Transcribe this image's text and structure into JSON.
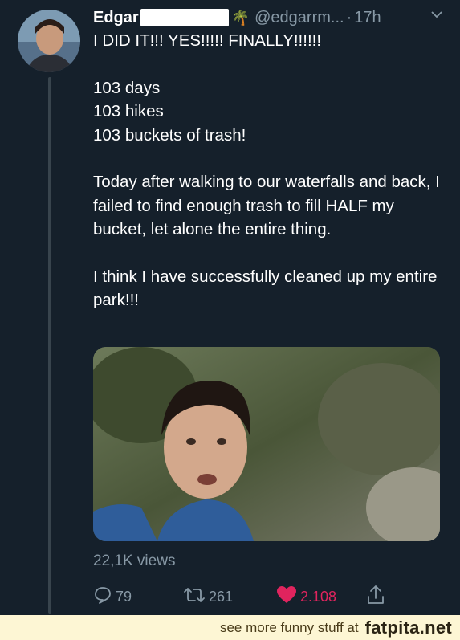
{
  "tweet": {
    "author_name": "Edgar",
    "author_emoji": "🌴",
    "handle": "@edgarrm...",
    "separator": "·",
    "time": "17h",
    "paragraphs": [
      "I DID IT!!! YES!!!!! FINALLY!!!!!!",
      "103 days\n103 hikes\n103 buckets of trash!",
      "Today after walking to our waterfalls and back, I failed to find enough trash to fill HALF my bucket, let alone the entire thing.",
      "I think I have successfully cleaned up my entire park!!!"
    ],
    "views": "22,1K views",
    "replies": "79",
    "retweets": "261",
    "likes": "2.108",
    "colors": {
      "background": "#15202b",
      "secondary_text": "#8899a6",
      "like": "#e0245e"
    }
  },
  "icons": {
    "caret": "chevron-down-icon",
    "reply": "reply-icon",
    "retweet": "retweet-icon",
    "like": "heart-icon",
    "share": "share-icon"
  },
  "banner": {
    "text": "see more funny stuff at",
    "brand": "fatpita.net"
  }
}
